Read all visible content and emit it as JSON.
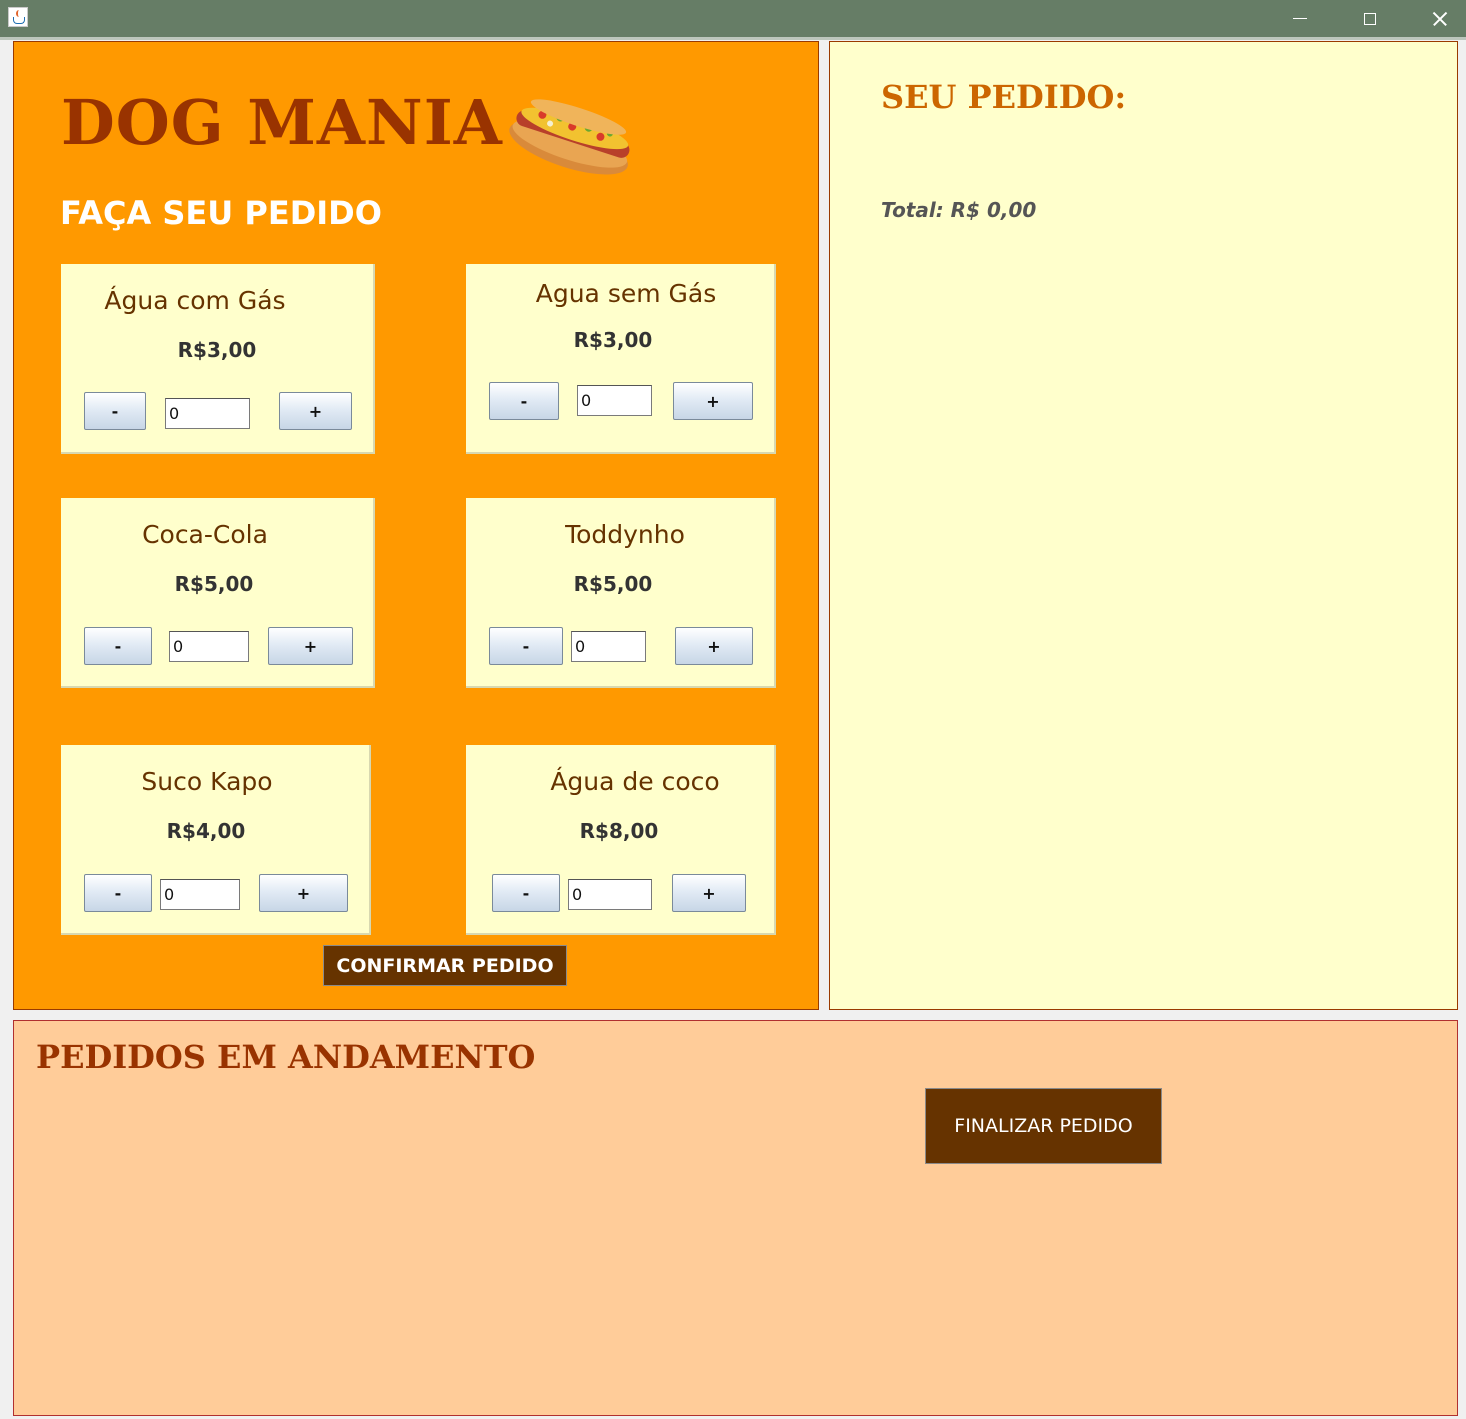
{
  "window": {
    "icon": "java-cup-icon",
    "controls": [
      "minimize-icon",
      "maximize-icon",
      "close-icon"
    ]
  },
  "order_panel": {
    "brand": "DOG MANIA",
    "brand_image": "hotdog-image",
    "subtitle": "FAÇA SEU PEDIDO",
    "confirm_label": "CONFIRMAR PEDIDO",
    "products": [
      {
        "name": "Água com Gás",
        "price": "R$3,00",
        "quantity": "0",
        "minus": "-",
        "plus": "+"
      },
      {
        "name": "Agua sem Gás",
        "price": "R$3,00",
        "quantity": "0",
        "minus": "-",
        "plus": "+"
      },
      {
        "name": "Coca-Cola",
        "price": "R$5,00",
        "quantity": "0",
        "minus": "-",
        "plus": "+"
      },
      {
        "name": "Toddynho",
        "price": "R$5,00",
        "quantity": "0",
        "minus": "-",
        "plus": "+"
      },
      {
        "name": "Suco Kapo",
        "price": "R$4,00",
        "quantity": "0",
        "minus": "-",
        "plus": "+"
      },
      {
        "name": "Água de coco",
        "price": "R$8,00",
        "quantity": "0",
        "minus": "-",
        "plus": "+"
      }
    ]
  },
  "summary_panel": {
    "title": "SEU PEDIDO:",
    "total": "Total: R$ 0,00"
  },
  "progress_panel": {
    "title": "PEDIDOS EM ANDAMENTO",
    "finalize_label": "FINALIZAR PEDIDO"
  },
  "colors": {
    "order_bg": "#ff9900",
    "card_bg": "#ffffcc",
    "brand": "#993300",
    "button_dark": "#663300",
    "progress_bg": "#ffcc99",
    "titlebar": "#667d66"
  }
}
